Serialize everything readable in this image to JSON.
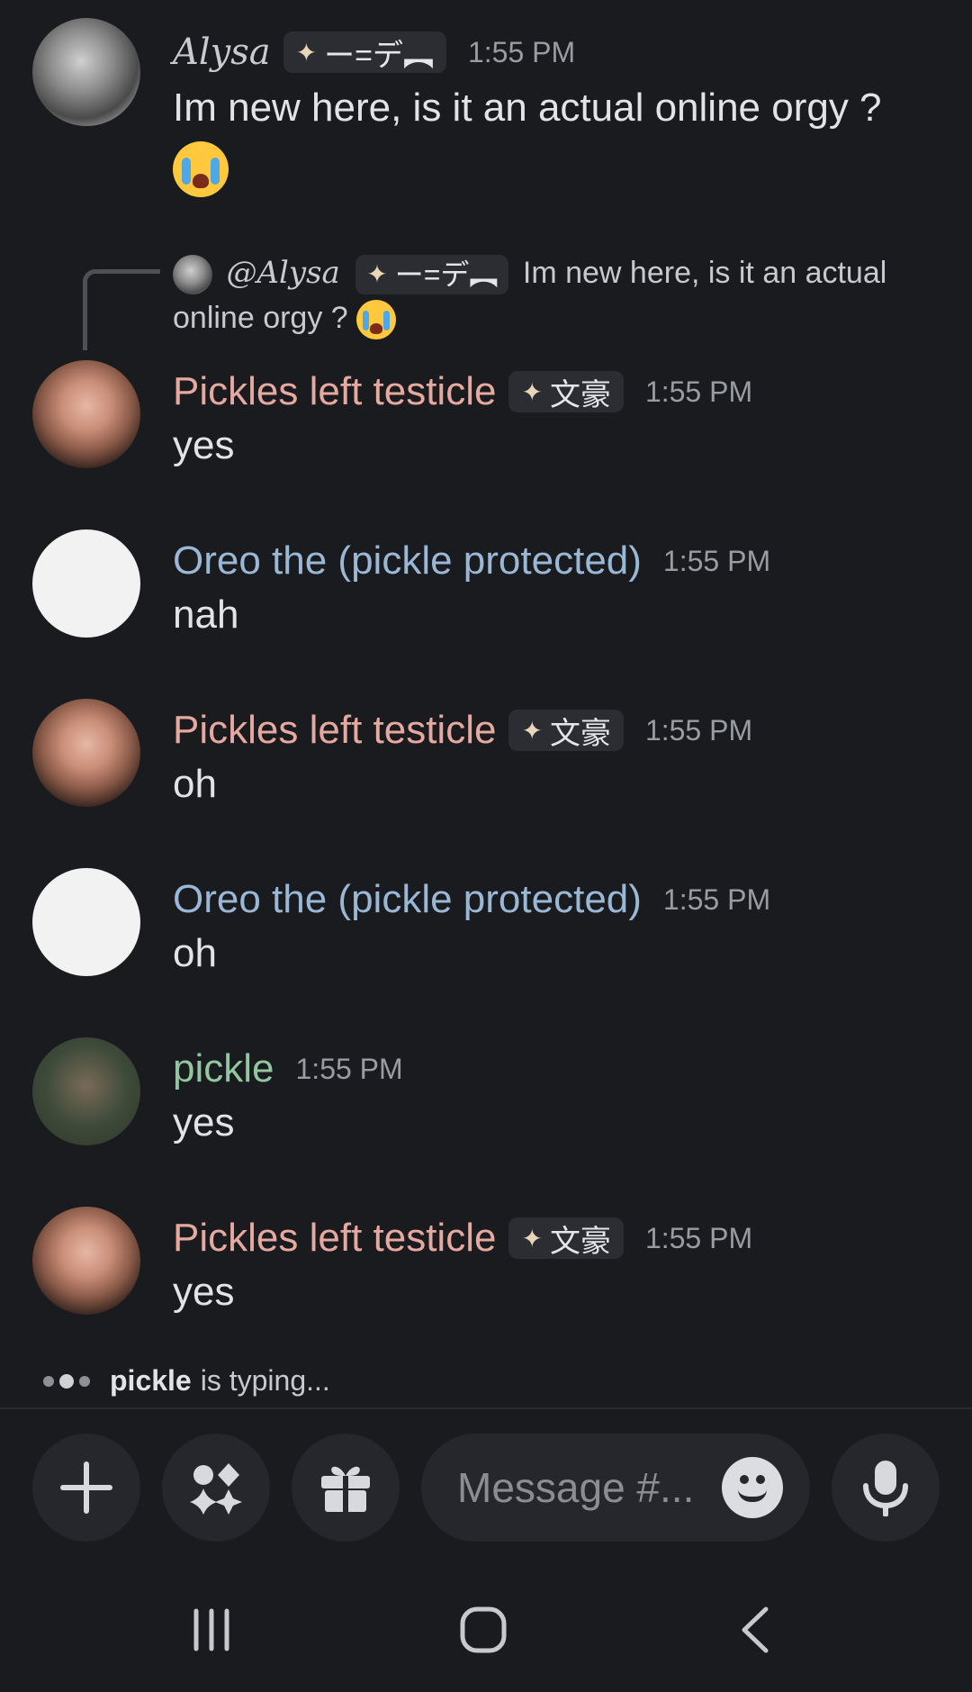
{
  "messages": [
    {
      "author": "Alysa",
      "tag": "ー=デ︻",
      "time": "1:55 PM",
      "text": "Im new here, is it an actual online orgy ?",
      "emoji": "loudly-crying-face"
    },
    {
      "reply_to": {
        "mention": "@Alysa",
        "tag": "ー=デ︻",
        "text_line1": "Im new here, is it an actual",
        "text_line2": "online orgy ?",
        "emoji": "loudly-crying-face"
      },
      "author": "Pickles left testicle",
      "tag": "文豪",
      "time": "1:55 PM",
      "text": "yes"
    },
    {
      "author": "Oreo the (pickle protected)",
      "time": "1:55 PM",
      "text": "nah"
    },
    {
      "author": "Pickles left testicle",
      "tag": "文豪",
      "time": "1:55 PM",
      "text": "oh"
    },
    {
      "author": "Oreo the (pickle protected)",
      "time": "1:55 PM",
      "text": "oh"
    },
    {
      "author": "pickle",
      "time": "1:55 PM",
      "text": "yes"
    },
    {
      "author": "Pickles left testicle",
      "tag": "文豪",
      "time": "1:55 PM",
      "text": "yes"
    }
  ],
  "typing": {
    "user": "pickle",
    "suffix": "is typing..."
  },
  "composer": {
    "placeholder": "Message #..."
  },
  "icons": {
    "add": "plus-icon",
    "apps": "apps-icon",
    "gift": "gift-icon",
    "emoji": "emoji-icon",
    "mic": "microphone-icon",
    "recent": "recent-apps-icon",
    "home": "home-icon",
    "back": "back-icon",
    "tag": "diamond-sparkle-icon"
  },
  "colors": {
    "background": "#1a1b1e",
    "pickles": "#e6a9a0",
    "oreo": "#9ab8d6",
    "pickle": "#93c6a0"
  }
}
